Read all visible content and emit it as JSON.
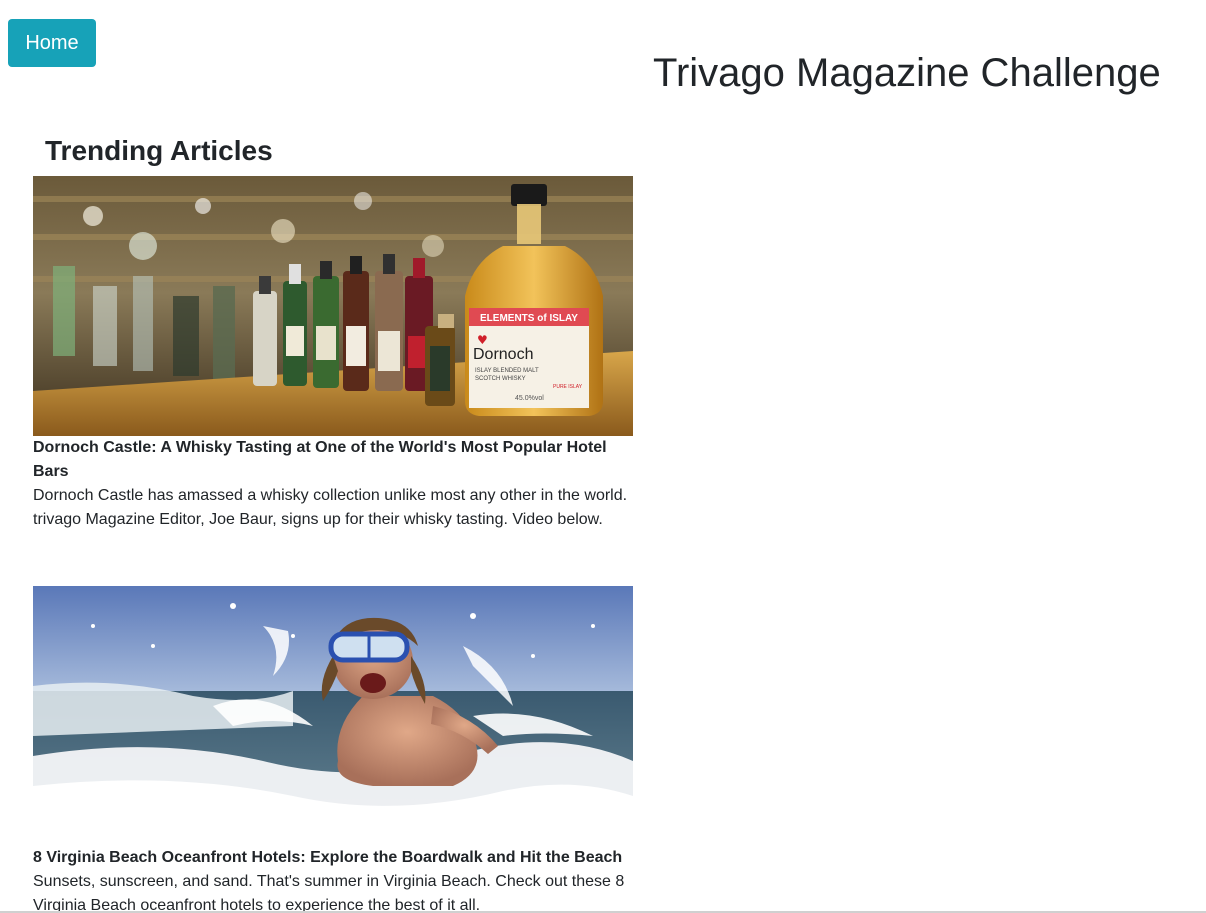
{
  "nav": {
    "home_label": "Home"
  },
  "header": {
    "title": "Trivago Magazine Challenge"
  },
  "main": {
    "section_title": "Trending Articles",
    "articles": [
      {
        "title": "Dornoch Castle: A Whisky Tasting at One of the World's Most Popular Hotel Bars",
        "description": "Dornoch Castle has amassed a whisky collection unlike most any other in the world. trivago Magazine Editor, Joe Baur, signs up for their whisky tasting. Video below.",
        "image_label": {
          "brand": "ELEMENTS of ISLAY",
          "heart": "♥",
          "name": "Dornoch",
          "line1": "ISLAY BLENDED MALT",
          "line2": "SCOTCH WHISKY",
          "stamp": "PURE ISLAY",
          "abv": "45.0%vol"
        }
      },
      {
        "title": "8 Virginia Beach Oceanfront Hotels: Explore the Boardwalk and Hit the Beach",
        "description": "Sunsets, sunscreen, and sand. That's summer in Virginia Beach. Check out these 8 Virginia Beach oceanfront hotels to experience the best of it all."
      }
    ]
  },
  "colors": {
    "primary_button": "#17a2b8",
    "text": "#212529"
  }
}
